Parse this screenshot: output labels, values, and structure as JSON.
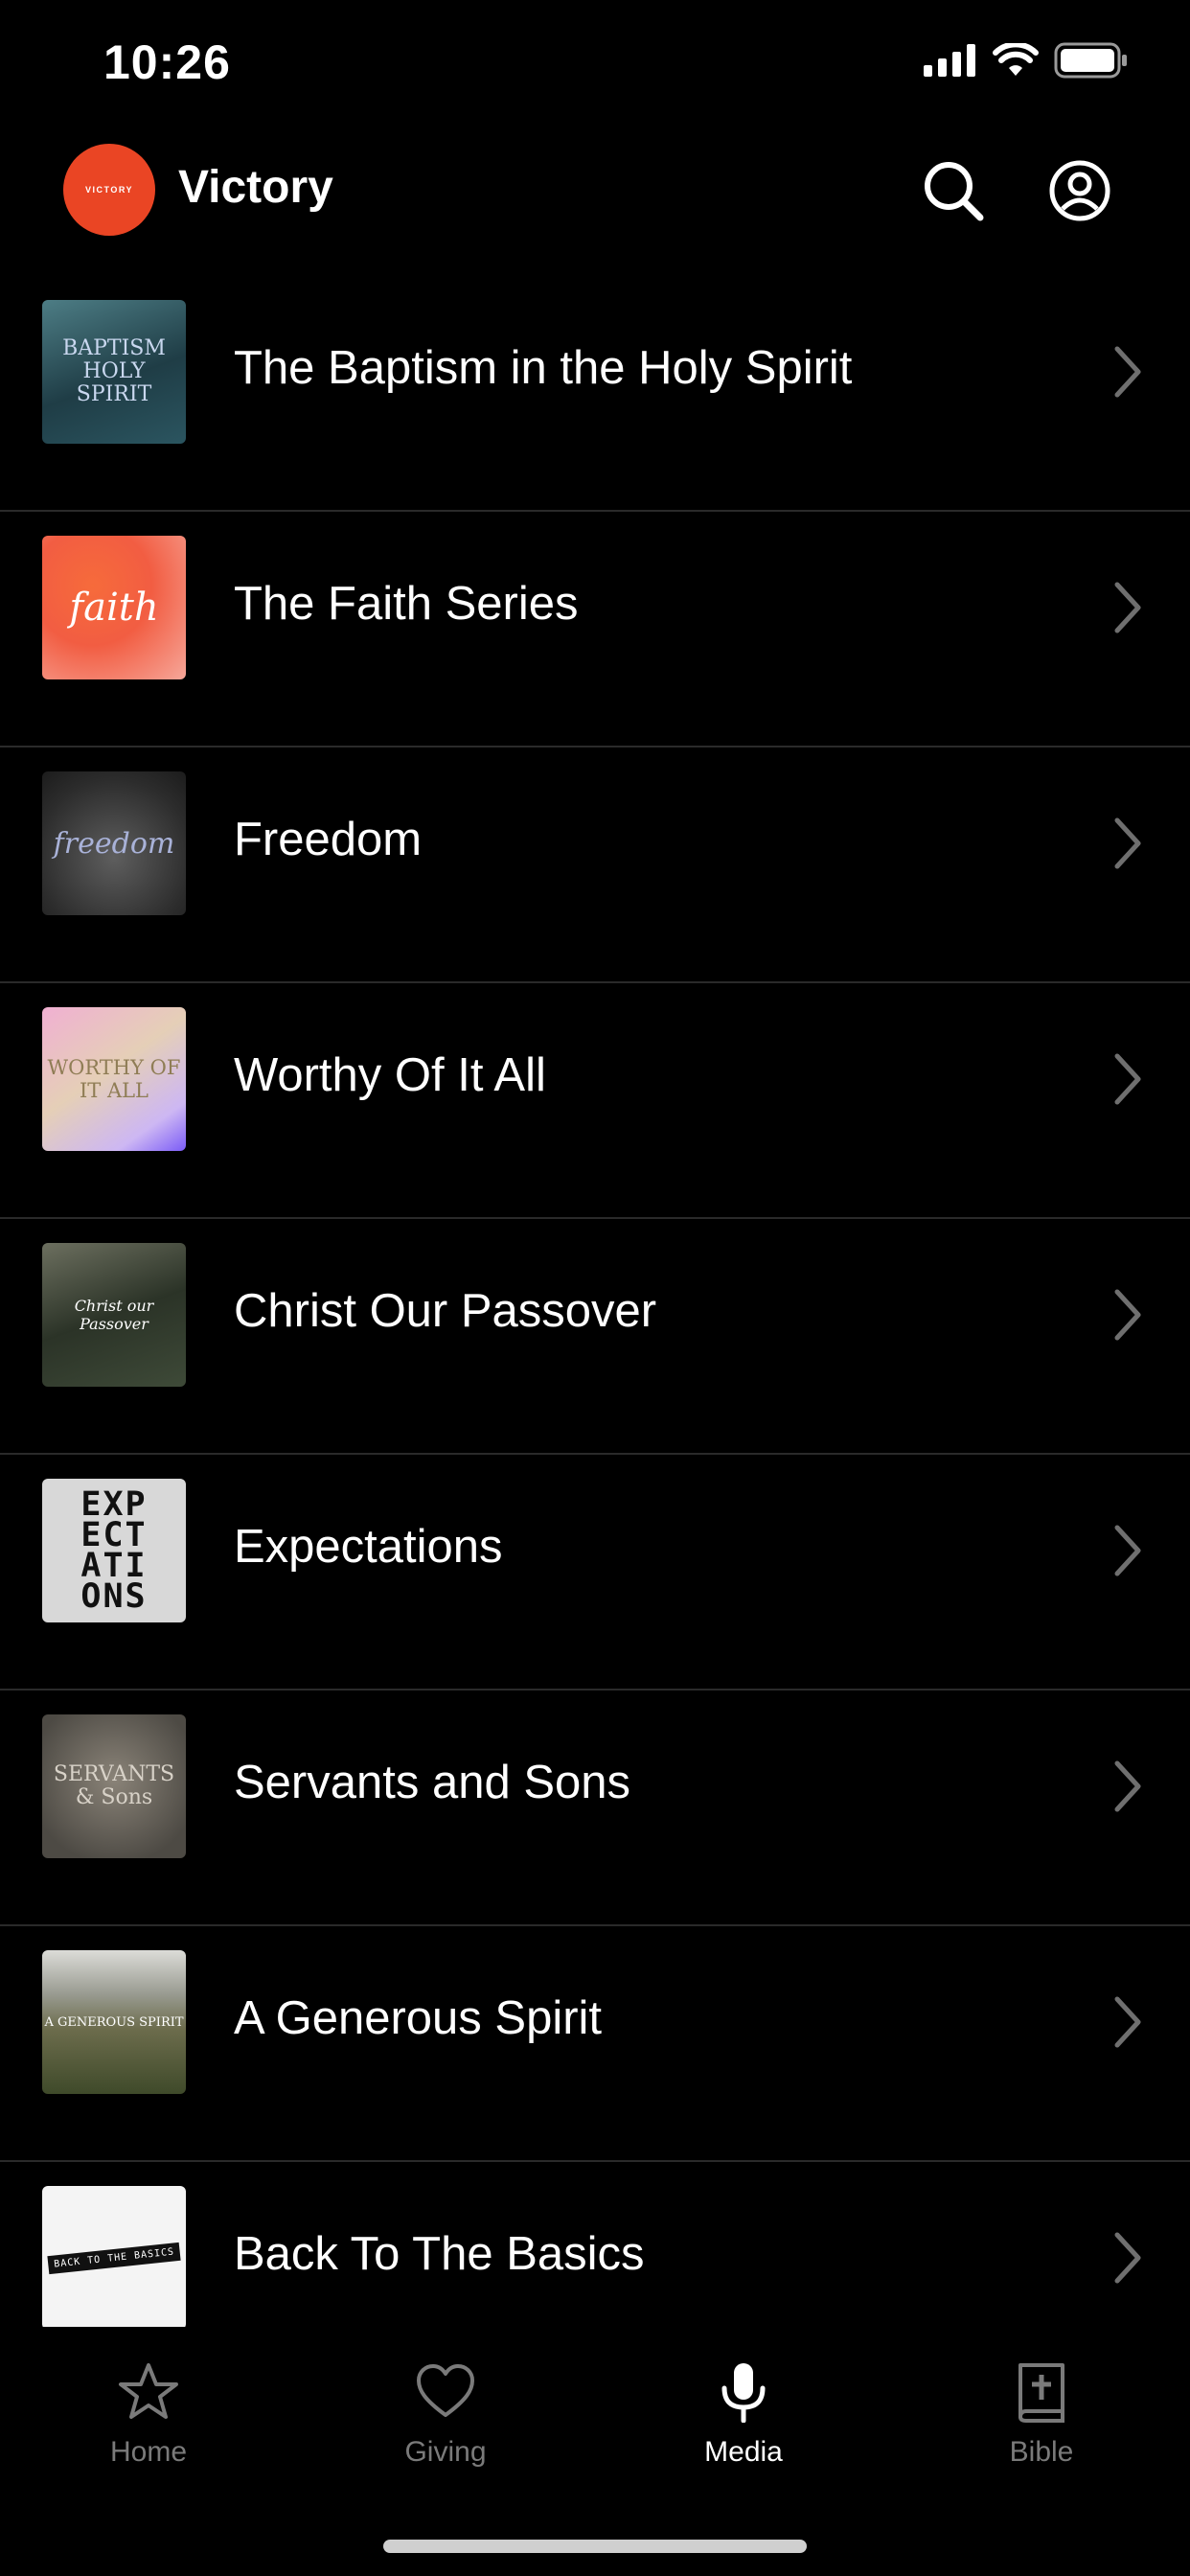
{
  "status_bar": {
    "time": "10:26"
  },
  "header": {
    "logo_text": "VICTORY",
    "title": "Victory"
  },
  "series": [
    {
      "title": "The Baptism in the Holy Spirit",
      "art": "BAPTISM HOLY SPIRIT"
    },
    {
      "title": "The Faith Series",
      "art": "faith"
    },
    {
      "title": "Freedom",
      "art": "freedom"
    },
    {
      "title": "Worthy Of It All",
      "art": "WORTHY OF IT ALL"
    },
    {
      "title": "Christ Our Passover",
      "art": "Christ our Passover"
    },
    {
      "title": "Expectations",
      "art": "EXP ECT ATI ONS"
    },
    {
      "title": "Servants and Sons",
      "art": "SERVANTS & Sons"
    },
    {
      "title": "A Generous Spirit",
      "art": "A GENEROUS SPIRIT"
    },
    {
      "title": "Back To The Basics",
      "art": "BACK TO THE BASICS"
    }
  ],
  "tabs": [
    {
      "label": "Home",
      "icon": "star-icon",
      "active": false
    },
    {
      "label": "Giving",
      "icon": "heart-icon",
      "active": false
    },
    {
      "label": "Media",
      "icon": "microphone-icon",
      "active": true
    },
    {
      "label": "Bible",
      "icon": "bible-icon",
      "active": false
    }
  ],
  "colors": {
    "background": "#000000",
    "accent": "#ea4524",
    "inactive_tab": "#7a7a7a"
  }
}
